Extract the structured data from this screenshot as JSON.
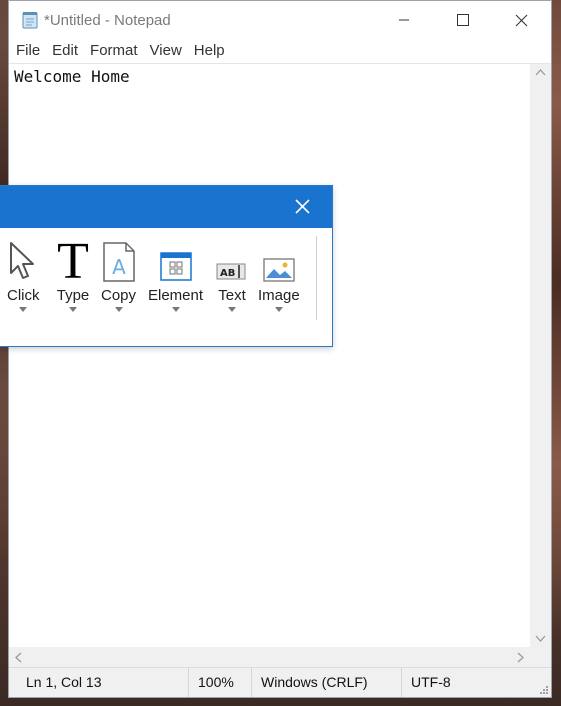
{
  "window": {
    "title": "*Untitled - Notepad",
    "icons": [
      "notepad-icon",
      "minimize-icon",
      "maximize-icon",
      "close-icon"
    ]
  },
  "menu": [
    "File",
    "Edit",
    "Format",
    "View",
    "Help"
  ],
  "editor": {
    "text": "Welcome Home"
  },
  "status": {
    "position": "Ln 1, Col 13",
    "zoom": "100%",
    "line_endings": "Windows (CRLF)",
    "encoding": "UTF-8"
  },
  "toolbar": {
    "accent": "#1a73cf",
    "tools": [
      {
        "label": "Click",
        "icon": "cursor-icon"
      },
      {
        "label": "Type",
        "icon": "type-icon"
      },
      {
        "label": "Copy",
        "icon": "copy-icon"
      },
      {
        "label": "Element",
        "icon": "element-icon"
      },
      {
        "label": "Text",
        "icon": "text-icon"
      },
      {
        "label": "Image",
        "icon": "image-icon"
      }
    ]
  }
}
